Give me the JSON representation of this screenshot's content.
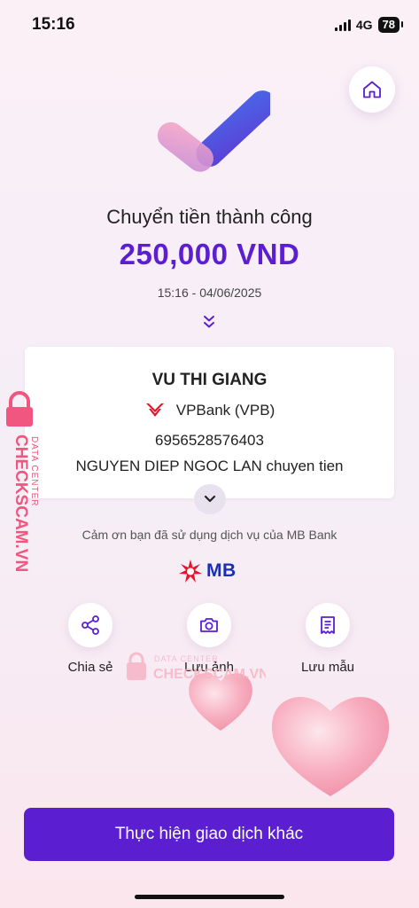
{
  "status_bar": {
    "time": "15:16",
    "network": "4G",
    "battery": "78"
  },
  "result": {
    "title": "Chuyển tiền thành công",
    "amount": "250,000 VND",
    "datetime": "15:16 - 04/06/2025"
  },
  "details": {
    "recipient_name": "VU THI GIANG",
    "bank": "VPBank (VPB)",
    "account_number": "6956528576403",
    "message": "NGUYEN DIEP NGOC LAN chuyen tien"
  },
  "thanks_text": "Cảm ơn bạn đã sử dụng dịch vụ của MB Bank",
  "brand": {
    "logo_text": "MB"
  },
  "actions": [
    {
      "label": "Chia sẻ",
      "icon": "share-icon"
    },
    {
      "label": "Lưu ảnh",
      "icon": "camera-icon"
    },
    {
      "label": "Lưu mẫu",
      "icon": "receipt-icon"
    }
  ],
  "primary_button": "Thực hiện giao dịch khác",
  "watermark": {
    "top_line": "DATA CENTER",
    "main_line": "CHECKSCAM.VN"
  },
  "colors": {
    "accent": "#5b1fd1",
    "mb_blue": "#1b2fb0",
    "mb_red": "#e5142a",
    "watermark": "#f0567f"
  }
}
